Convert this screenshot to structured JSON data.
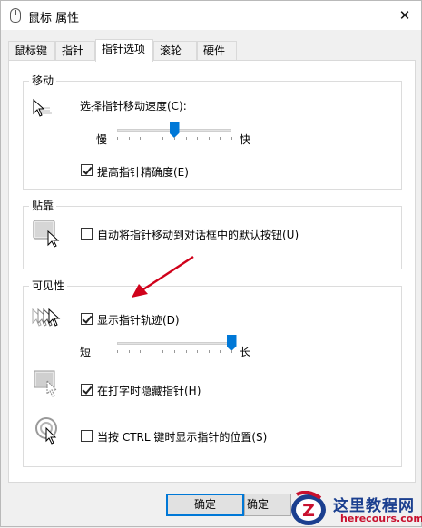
{
  "window": {
    "title": "鼠标 属性",
    "close_glyph": "✕"
  },
  "tabs": [
    {
      "label": "鼠标键"
    },
    {
      "label": "指针"
    },
    {
      "label": "指针选项"
    },
    {
      "label": "滚轮"
    },
    {
      "label": "硬件"
    }
  ],
  "motion": {
    "legend": "移动",
    "speed_label": "选择指针移动速度(C):",
    "slow_label": "慢",
    "fast_label": "快",
    "speed_level": 0.5,
    "precision_label": "提高指针精确度(E)",
    "precision_checked": true
  },
  "snap": {
    "legend": "贴靠",
    "snap_label": "自动将指针移动到对话框中的默认按钮(U)",
    "snap_checked": false
  },
  "visibility": {
    "legend": "可见性",
    "trails_label": "显示指针轨迹(D)",
    "trails_checked": true,
    "short_label": "短",
    "long_label": "长",
    "trail_level": 1.0,
    "hide_label": "在打字时隐藏指针(H)",
    "hide_checked": true,
    "ctrl_label": "当按 CTRL 键时显示指针的位置(S)",
    "ctrl_checked": false
  },
  "buttons": {
    "ok": "确定",
    "ok2": "确定"
  },
  "watermark": {
    "title": "这里教程网",
    "url": "herecours.com",
    "logo_letter": "Z"
  },
  "colors": {
    "accent": "#0078d7",
    "annotation_arrow": "#d0021b"
  }
}
